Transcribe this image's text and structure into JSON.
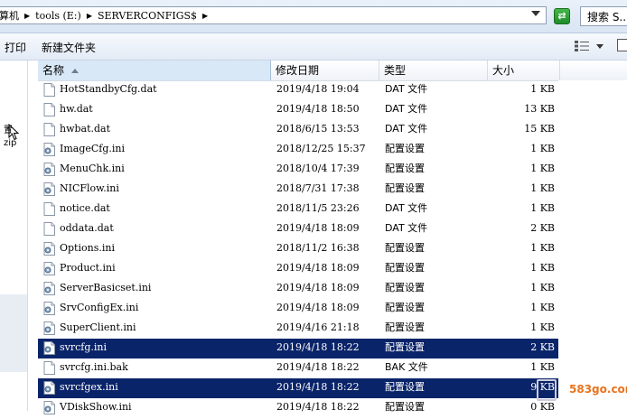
{
  "address": {
    "crumbs": [
      "计算机",
      "tools (E:)",
      "SERVERCONFIGS$"
    ],
    "search_placeholder": "搜索 S..."
  },
  "toolbar": {
    "print_label": "打印",
    "new_folder_label": "新建文件夹"
  },
  "nav": {
    "item1": "置",
    "item2": "zip"
  },
  "columns": {
    "name": "名称",
    "date": "修改日期",
    "type": "类型",
    "size": "大小"
  },
  "files": [
    {
      "name": "HotStandbyCfg.dat",
      "date": "2019/4/18 19:04",
      "type": "DAT 文件",
      "size": "1 KB",
      "icon": "dat-file-icon",
      "selected": false
    },
    {
      "name": "hw.dat",
      "date": "2019/4/18 18:50",
      "type": "DAT 文件",
      "size": "13 KB",
      "icon": "dat-file-icon",
      "selected": false
    },
    {
      "name": "hwbat.dat",
      "date": "2018/6/15 13:53",
      "type": "DAT 文件",
      "size": "15 KB",
      "icon": "dat-file-icon",
      "selected": false
    },
    {
      "name": "ImageCfg.ini",
      "date": "2018/12/25 15:37",
      "type": "配置设置",
      "size": "1 KB",
      "icon": "ini-file-icon",
      "selected": false
    },
    {
      "name": "MenuChk.ini",
      "date": "2018/10/4 17:39",
      "type": "配置设置",
      "size": "1 KB",
      "icon": "ini-file-icon",
      "selected": false
    },
    {
      "name": "NICFlow.ini",
      "date": "2018/7/31 17:38",
      "type": "配置设置",
      "size": "1 KB",
      "icon": "ini-file-icon",
      "selected": false
    },
    {
      "name": "notice.dat",
      "date": "2018/11/5 23:26",
      "type": "DAT 文件",
      "size": "1 KB",
      "icon": "dat-file-icon",
      "selected": false
    },
    {
      "name": "oddata.dat",
      "date": "2019/4/18 18:09",
      "type": "DAT 文件",
      "size": "2 KB",
      "icon": "dat-file-icon",
      "selected": false
    },
    {
      "name": "Options.ini",
      "date": "2018/11/2 16:38",
      "type": "配置设置",
      "size": "1 KB",
      "icon": "ini-file-icon",
      "selected": false
    },
    {
      "name": "Product.ini",
      "date": "2019/4/18 18:09",
      "type": "配置设置",
      "size": "1 KB",
      "icon": "ini-file-icon",
      "selected": false
    },
    {
      "name": "ServerBasicset.ini",
      "date": "2019/4/18 18:09",
      "type": "配置设置",
      "size": "1 KB",
      "icon": "ini-file-icon",
      "selected": false
    },
    {
      "name": "SrvConfigEx.ini",
      "date": "2019/4/18 18:09",
      "type": "配置设置",
      "size": "1 KB",
      "icon": "ini-file-icon",
      "selected": false
    },
    {
      "name": "SuperClient.ini",
      "date": "2019/4/16 21:18",
      "type": "配置设置",
      "size": "1 KB",
      "icon": "ini-file-icon",
      "selected": false
    },
    {
      "name": "svrcfg.ini",
      "date": "2019/4/18 18:22",
      "type": "配置设置",
      "size": "2 KB",
      "icon": "ini-file-icon",
      "selected": true
    },
    {
      "name": "svrcfg.ini.bak",
      "date": "2019/4/18 18:22",
      "type": "BAK 文件",
      "size": "1 KB",
      "icon": "dat-file-icon",
      "selected": false
    },
    {
      "name": "svrcfgex.ini",
      "date": "2019/4/18 18:22",
      "type": "配置设置",
      "size": "9 KB",
      "icon": "ini-file-icon",
      "selected": true
    },
    {
      "name": "VDiskShow.ini",
      "date": "2019/4/18 18:22",
      "type": "配置设置",
      "size": "0 KB",
      "icon": "ini-file-icon",
      "selected": false
    }
  ],
  "watermark": "583go.com",
  "colors": {
    "selection": "#0a246a",
    "accent": "#1e8c2a"
  }
}
